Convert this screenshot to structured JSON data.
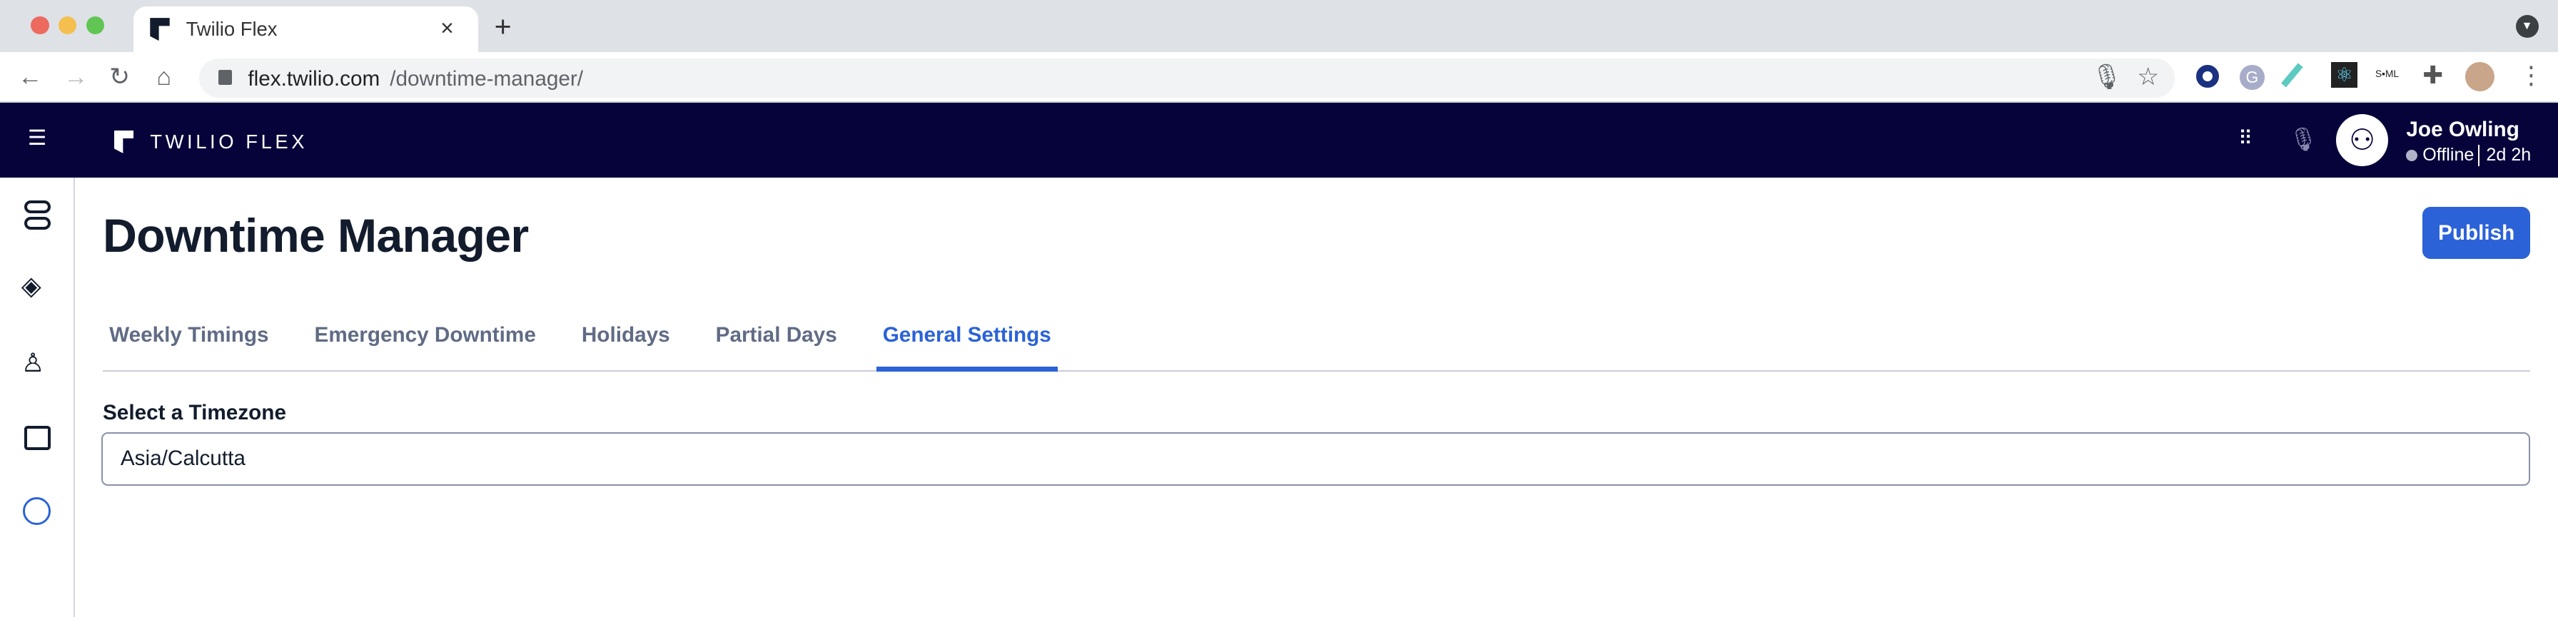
{
  "browser": {
    "tab_title": "Twilio Flex",
    "url_host": "flex.twilio.com",
    "url_path": "/downtime-manager/"
  },
  "nav": {
    "brand": "TWILIO FLEX",
    "user_name": "Joe Owling",
    "status": "Offline",
    "duration": "2d 2h"
  },
  "page": {
    "title": "Downtime Manager",
    "publish_label": "Publish"
  },
  "tabs": [
    {
      "label": "Weekly Timings"
    },
    {
      "label": "Emergency Downtime"
    },
    {
      "label": "Holidays"
    },
    {
      "label": "Partial Days"
    },
    {
      "label": "General Settings",
      "active": true
    }
  ],
  "settings": {
    "timezone_label": "Select a Timezone",
    "timezone_value": "Asia/Calcutta"
  },
  "colors": {
    "nav_bg": "#06033a",
    "accent": "#2b62d8"
  }
}
